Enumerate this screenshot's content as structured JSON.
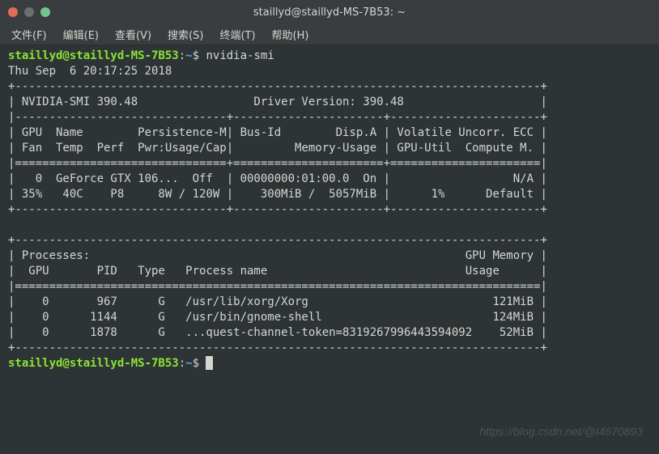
{
  "window": {
    "title": "staillyd@staillyd-MS-7B53: ~"
  },
  "menu": {
    "file": "文件(F)",
    "edit": "编辑(E)",
    "view": "查看(V)",
    "search": "搜索(S)",
    "terminal": "终端(T)",
    "help": "帮助(H)"
  },
  "prompt": {
    "user_host": "staillyd@staillyd-MS-7B53",
    "colon": ":",
    "path": "~",
    "dollar": "$"
  },
  "command": "nvidia-smi",
  "output": {
    "timestamp": "Thu Sep  6 20:17:25 2018       ",
    "line_top": "+-----------------------------------------------------------------------------+",
    "line_version": "| NVIDIA-SMI 390.48                 Driver Version: 390.48                    |",
    "line_hdr_sep": "|-------------------------------+----------------------+----------------------+",
    "line_hdr1": "| GPU  Name        Persistence-M| Bus-Id        Disp.A | Volatile Uncorr. ECC |",
    "line_hdr2": "| Fan  Temp  Perf  Pwr:Usage/Cap|         Memory-Usage | GPU-Util  Compute M. |",
    "line_hdr_sep2": "|===============================+======================+======================|",
    "line_gpu1": "|   0  GeForce GTX 106...  Off  | 00000000:01:00.0  On |                  N/A |",
    "line_gpu2": "| 35%   40C    P8     8W / 120W |    300MiB /  5057MiB |      1%      Default |",
    "line_gpu_sep": "+-------------------------------+----------------------+----------------------+",
    "line_blank": "                                                                               ",
    "line_proc_top": "+-----------------------------------------------------------------------------+",
    "line_proc_hdr1": "| Processes:                                                       GPU Memory |",
    "line_proc_hdr2": "|  GPU       PID   Type   Process name                             Usage      |",
    "line_proc_sep": "|=============================================================================|",
    "line_proc1": "|    0       967      G   /usr/lib/xorg/Xorg                           121MiB |",
    "line_proc2": "|    0      1144      G   /usr/bin/gnome-shell                         124MiB |",
    "line_proc3": "|    0      1878      G   ...quest-channel-token=8319267996443594092    52MiB |",
    "line_bottom": "+-----------------------------------------------------------------------------+"
  },
  "watermark": "https://blog.csdn.net/@I4670893",
  "chart_data": {
    "type": "table",
    "title": "nvidia-smi",
    "driver_version": "390.48",
    "nvidia_smi_version": "390.48",
    "timestamp": "Thu Sep 6 20:17:25 2018",
    "gpus": [
      {
        "gpu": 0,
        "name": "GeForce GTX 106...",
        "persistence_m": "Off",
        "bus_id": "00000000:01:00.0",
        "disp_a": "On",
        "ecc": "N/A",
        "fan_pct": 35,
        "temp_c": 40,
        "perf": "P8",
        "pwr_usage_w": 8,
        "pwr_cap_w": 120,
        "mem_used_mib": 300,
        "mem_total_mib": 5057,
        "gpu_util_pct": 1,
        "compute_mode": "Default"
      }
    ],
    "processes": [
      {
        "gpu": 0,
        "pid": 967,
        "type": "G",
        "name": "/usr/lib/xorg/Xorg",
        "mem_mib": 121
      },
      {
        "gpu": 0,
        "pid": 1144,
        "type": "G",
        "name": "/usr/bin/gnome-shell",
        "mem_mib": 124
      },
      {
        "gpu": 0,
        "pid": 1878,
        "type": "G",
        "name": "...quest-channel-token=8319267996443594092",
        "mem_mib": 52
      }
    ]
  }
}
